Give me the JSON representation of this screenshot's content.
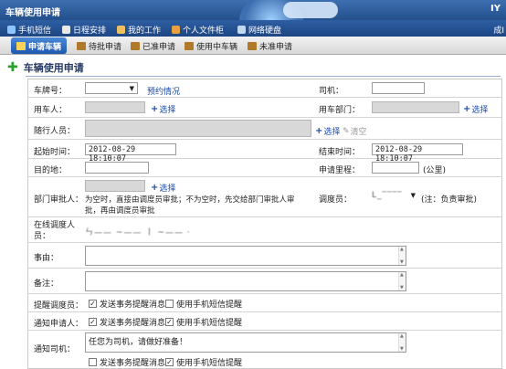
{
  "window": {
    "title": "车辆使用申请",
    "controls": "IY"
  },
  "nav": {
    "items": [
      {
        "label": "手机短信"
      },
      {
        "label": "日程安排"
      },
      {
        "label": "我的工作"
      },
      {
        "label": "个人文件柜"
      },
      {
        "label": "网络硬盘"
      }
    ],
    "user": "成I"
  },
  "tabs": [
    {
      "label": "申请车辆"
    },
    {
      "label": "待批申请"
    },
    {
      "label": "已准申请"
    },
    {
      "label": "使用中车辆"
    },
    {
      "label": "未准申请"
    }
  ],
  "page_title": "车辆使用申请",
  "form": {
    "plate_label": "车牌号：",
    "reservation": "预约情况",
    "driver_label": "司机：",
    "user_label": "用车人：",
    "select_label": "选择",
    "dept_label": "用车部门：",
    "companions_label": "随行人员：",
    "clear_label": "清空",
    "start_label": "起始时间：",
    "start_value": "2012-08-29 18:10:07",
    "end_label": "结束时间：",
    "end_value": "2012-08-29 18:10:07",
    "destination_label": "目的地：",
    "mileage_label": "申请里程：",
    "mileage_unit": "(公里)",
    "approver_label": "部门审批人：",
    "approver_note": "为空时，直接由调度员审批；不为空时，先交给部门审批人审批，再由调度员审批",
    "dispatcher_label": "调度员：",
    "dispatcher_value": "L_‾‾‾‾",
    "dispatcher_note": "(注：负责审批)",
    "online_label": "在线调度人员：",
    "online_value": "ㄣ—— ~——  ㅣ ~—— ·",
    "reason_label": "事由：",
    "remark_label": "备注：",
    "remind_dispatcher_label": "提醒调度员：",
    "notify_applicant_label": "通知申请人：",
    "notify_driver_label": "通知司机：",
    "send_msg": "发送事务提醒消息",
    "send_sms": "使用手机短信提醒",
    "driver_message": "任您为司机，请做好准备！",
    "remind_msg_checked": "✓",
    "remind_sms_checked": "",
    "applicant_msg_checked": "✓",
    "applicant_sms_checked": "✓",
    "driver_msg_checked": "",
    "driver_sms_checked": "✓"
  }
}
